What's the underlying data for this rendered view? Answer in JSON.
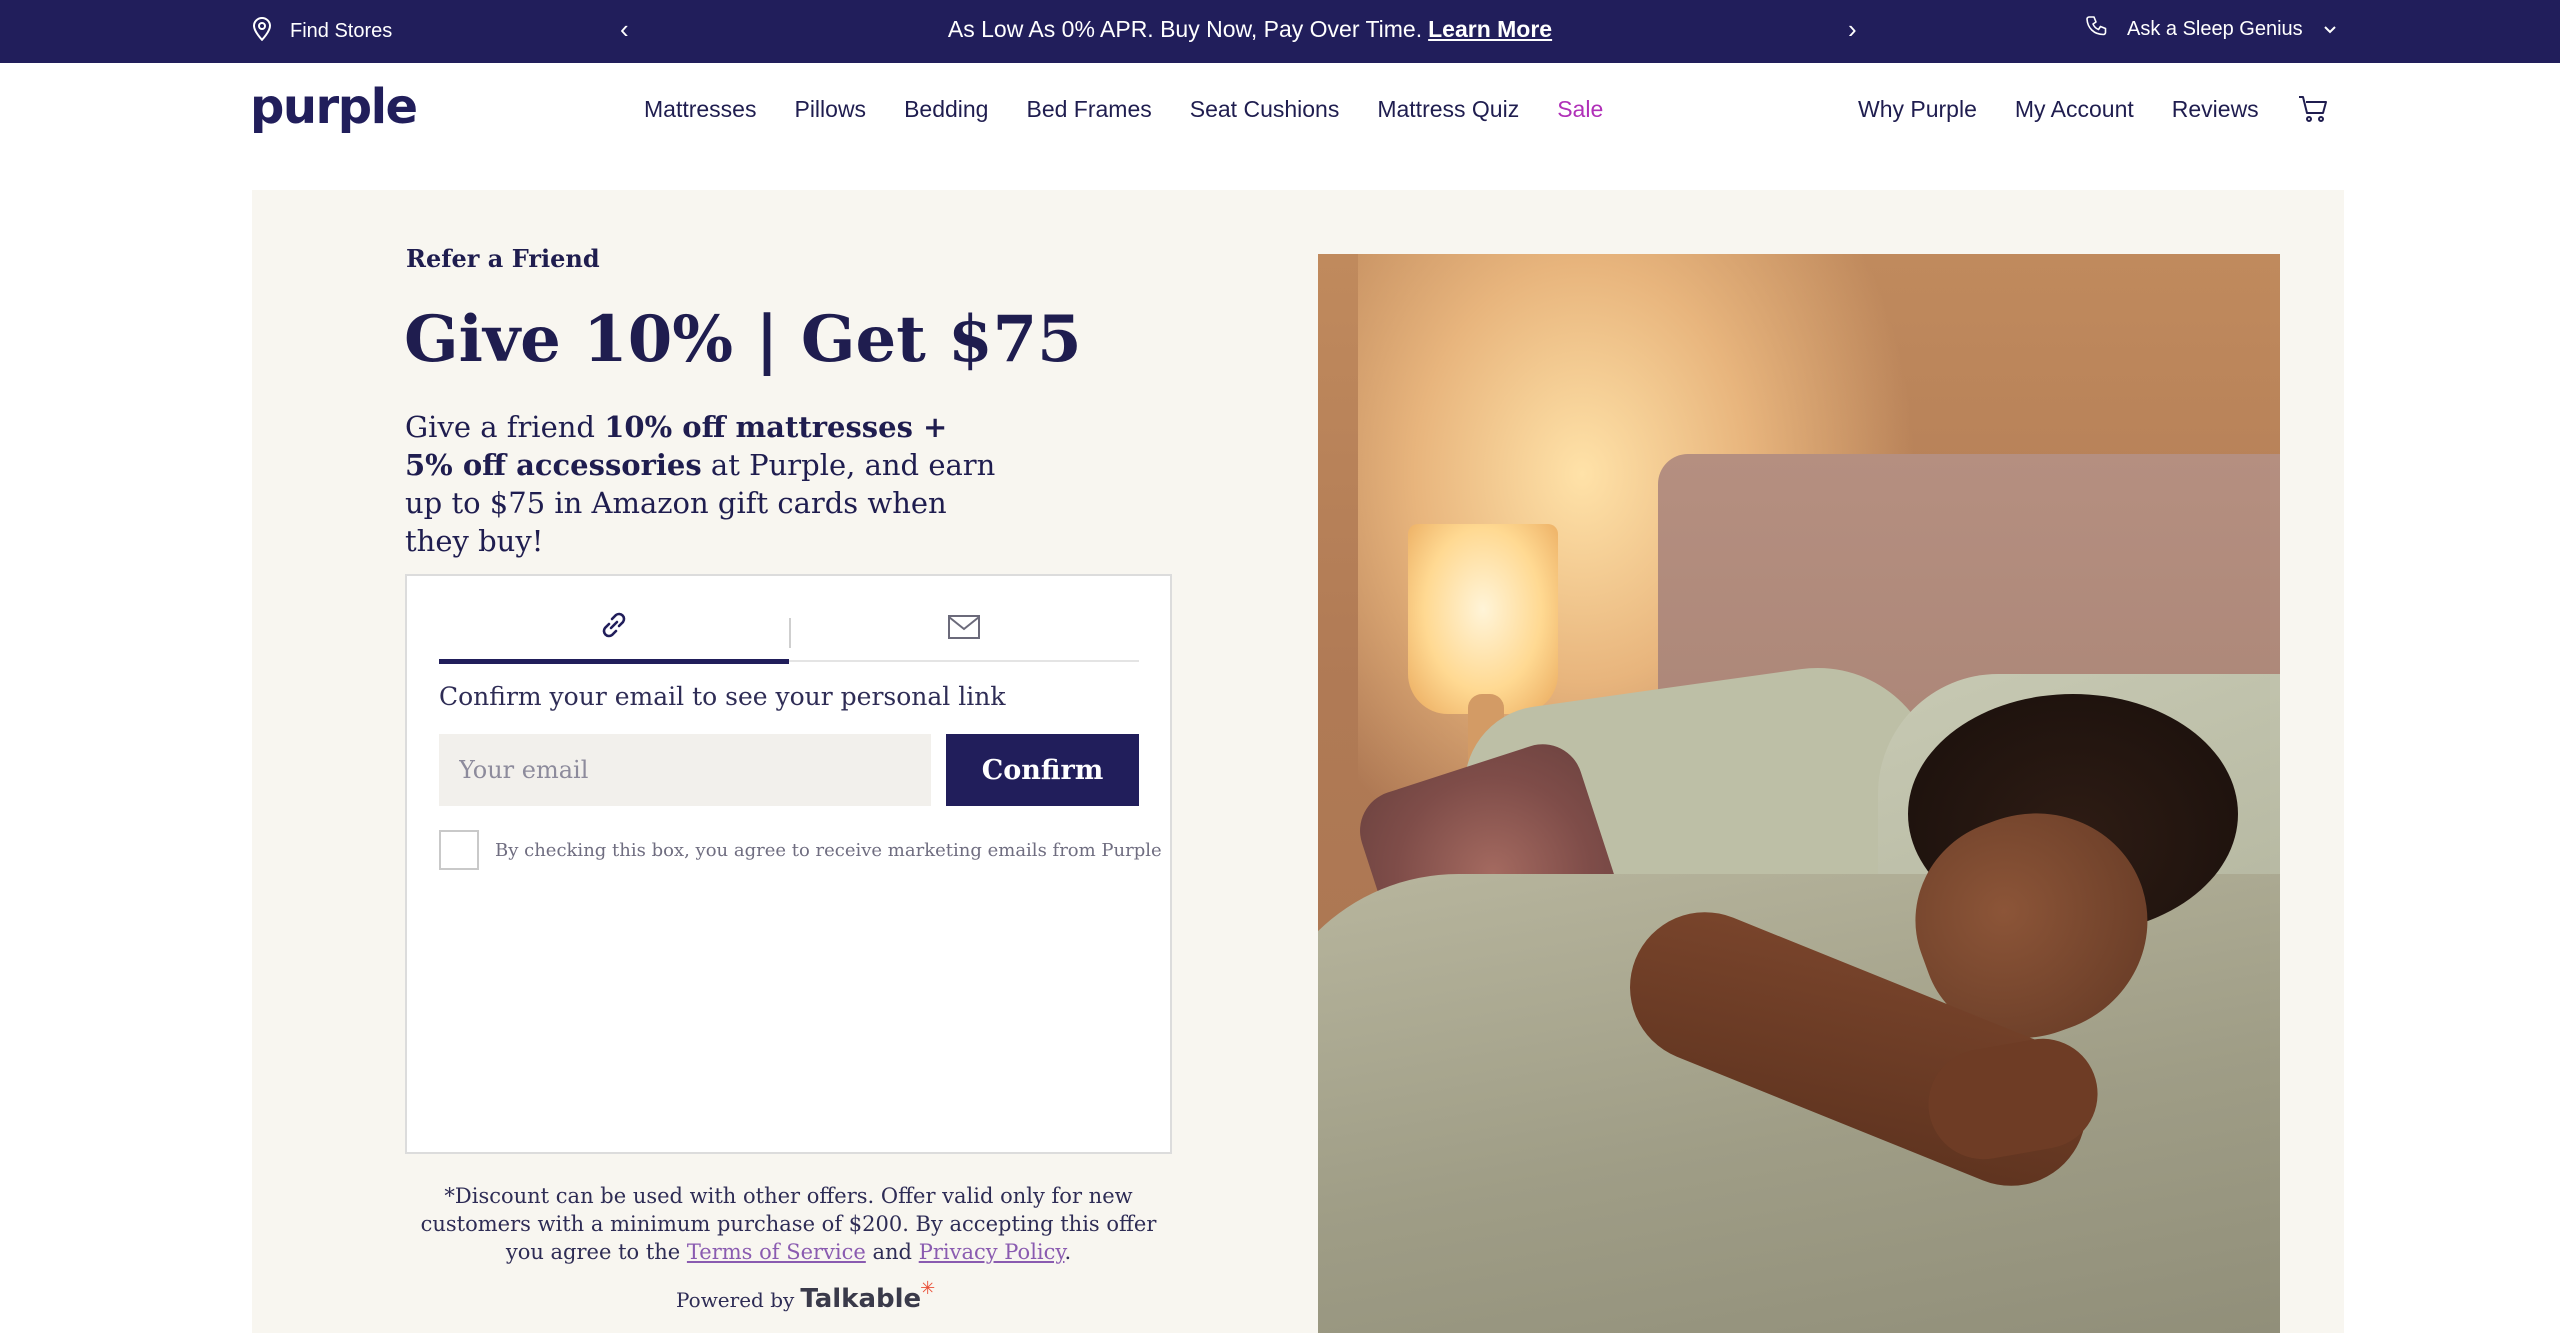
{
  "topbar": {
    "find_stores": "Find Stores",
    "promo_text": "As Low As 0% APR. Buy Now, Pay Over Time.",
    "promo_link": "Learn More",
    "prev_arrow": "‹",
    "next_arrow": "›",
    "sleep_genius": "Ask a Sleep Genius"
  },
  "nav": {
    "logo": "purple",
    "links": [
      "Mattresses",
      "Pillows",
      "Bedding",
      "Bed Frames",
      "Seat Cushions",
      "Mattress Quiz",
      "Sale"
    ],
    "right_links": [
      "Why Purple",
      "My Account",
      "Reviews"
    ]
  },
  "referral": {
    "eyebrow": "Refer a Friend",
    "headline": "Give 10% | Get $75",
    "intro_prefix": "Give a friend",
    "intro_bold": "10% off mattresses + 5% off accessories",
    "intro_suffix": "at Purple, and earn up to $75 in Amazon gift cards when they buy!"
  },
  "widget": {
    "tabs": [
      {
        "icon": "link-icon",
        "active": true
      },
      {
        "icon": "mail-icon",
        "active": false
      }
    ],
    "prompt": "Confirm your email to see your personal link",
    "email_placeholder": "Your email",
    "email_value": "",
    "confirm_label": "Confirm",
    "consent_label": "By checking this box, you agree to receive marketing emails from Purple",
    "consent_checked": false
  },
  "disclaimer": {
    "text_before": "*Discount can be used with other offers. Offer valid only for new customers with a minimum purchase of $200. By accepting this offer you agree to the",
    "terms_link": "Terms of Service",
    "and": "and",
    "privacy_link": "Privacy Policy",
    "end": "."
  },
  "powered_by": {
    "label": "Powered by",
    "brand": "Talkable"
  },
  "colors": {
    "brand_navy": "#211e5b",
    "sale_magenta": "#b02fb8",
    "panel_bg": "#f8f6f0",
    "link_purple": "#8a5bb0"
  }
}
